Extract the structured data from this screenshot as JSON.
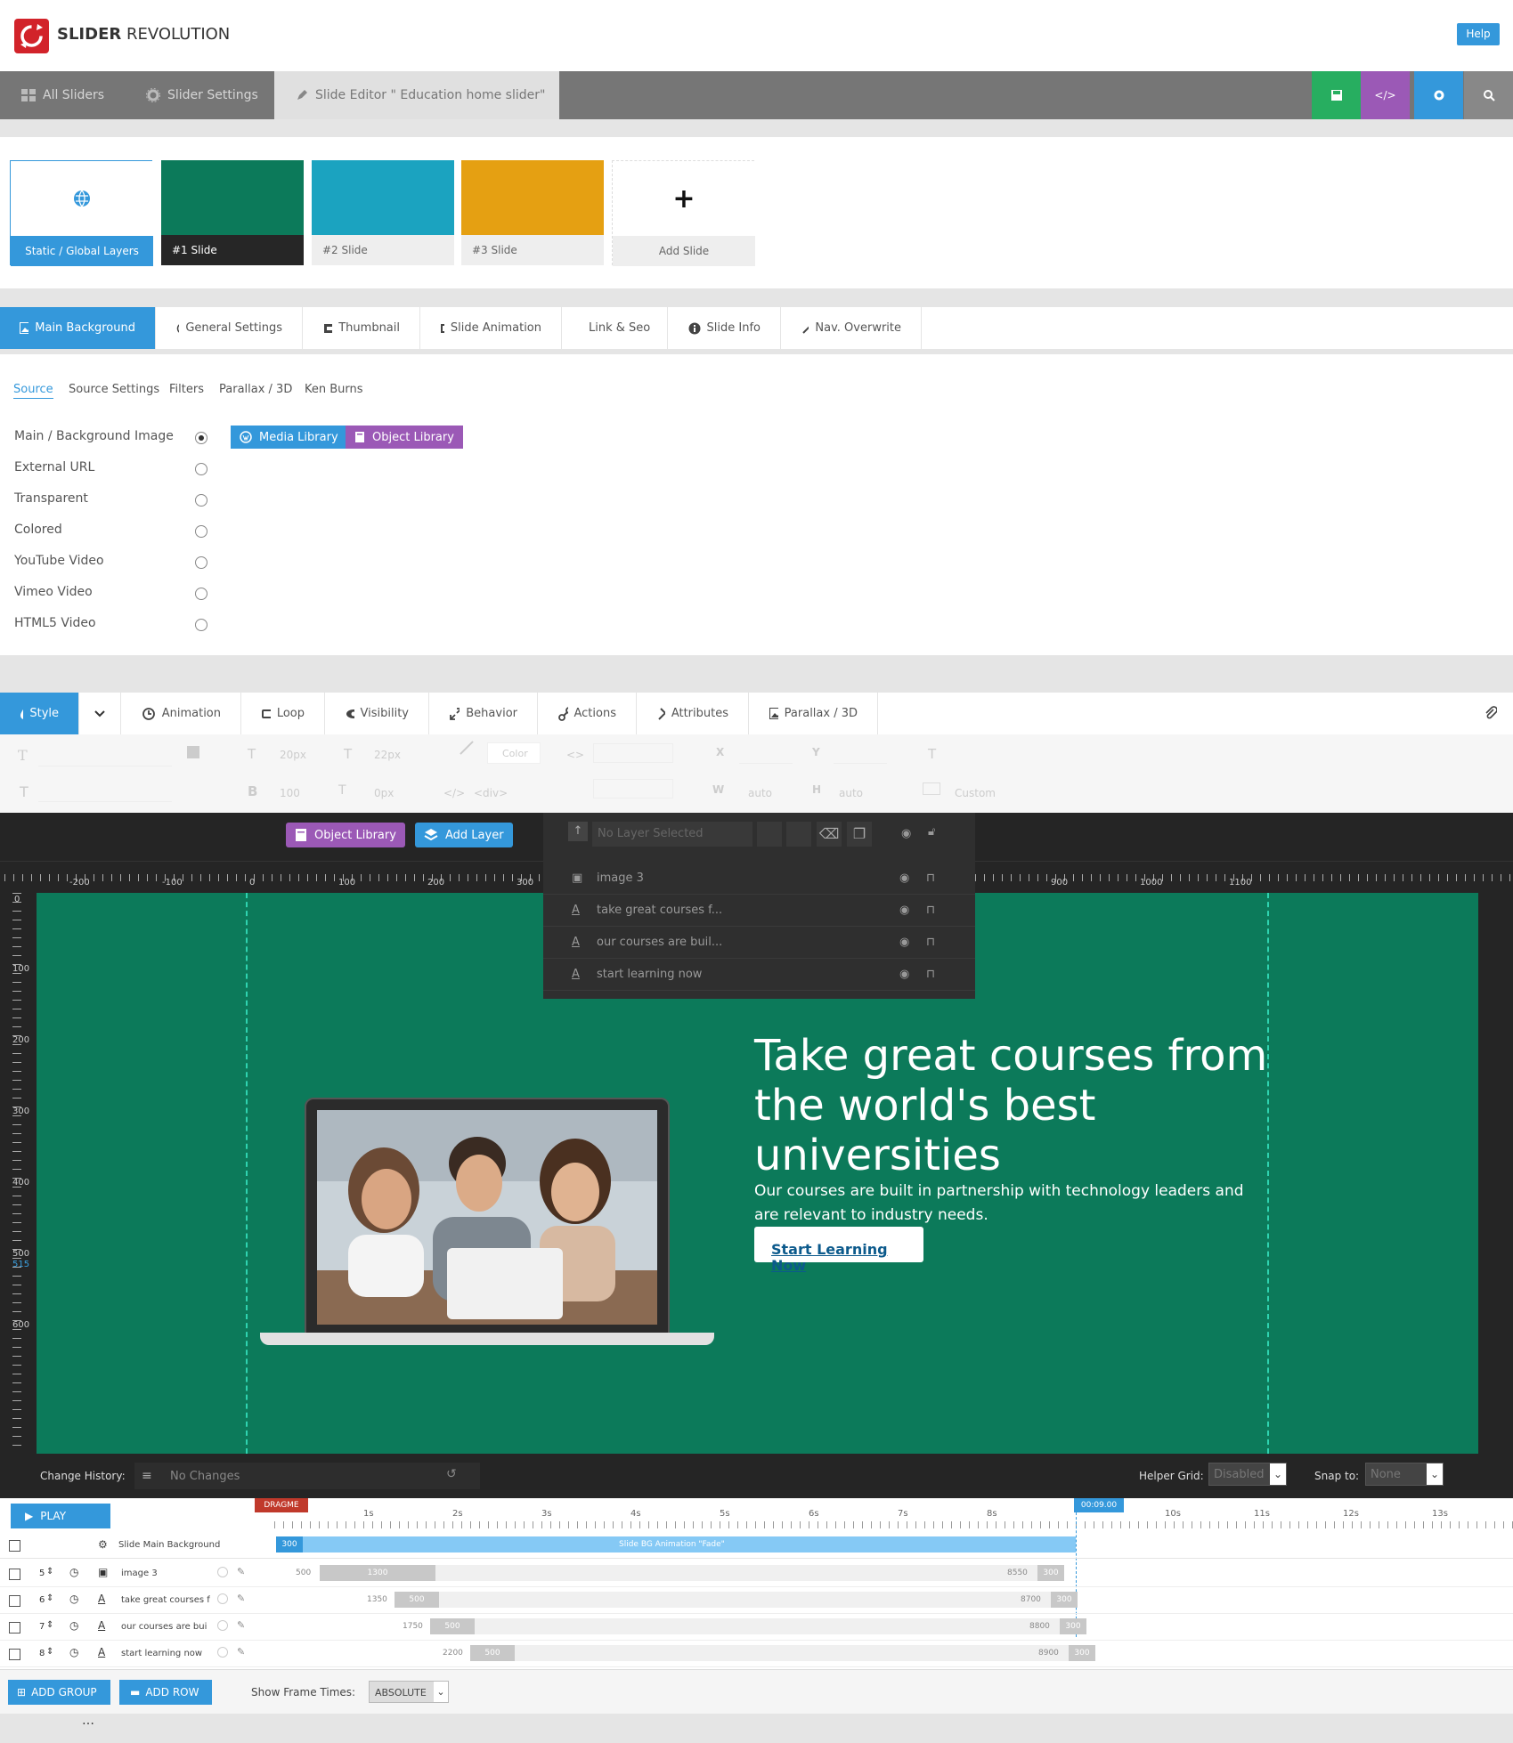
{
  "app": {
    "brand_bold": "SLIDER",
    "brand_light": "REVOLUTION",
    "help_label": "Help"
  },
  "nav": {
    "items": [
      "All Sliders",
      "Slider Settings"
    ],
    "editor_label": "Slide Editor \" Education home slider\"",
    "actions": [
      "save-icon",
      "code-icon",
      "gear-icon",
      "search-icon"
    ]
  },
  "slides": [
    {
      "label": "Static / Global Layers",
      "color": "#ffffff"
    },
    {
      "label": "#1 Slide",
      "color": "#0c7a5a"
    },
    {
      "label": "#2 Slide",
      "color": "#1ba3c0"
    },
    {
      "label": "#3 Slide",
      "color": "#e5a012"
    },
    {
      "label": "Add Slide",
      "color": "#ffffff"
    }
  ],
  "slide_tabs": [
    "Main Background",
    "General Settings",
    "Thumbnail",
    "Slide Animation",
    "Link & Seo",
    "Slide Info",
    "Nav. Overwrite"
  ],
  "source_subtabs": [
    "Source",
    "Source Settings",
    "Filters",
    "Parallax / 3D",
    "Ken Burns"
  ],
  "source_options": [
    "Main / Background Image",
    "External URL",
    "Transparent",
    "Colored",
    "YouTube Video",
    "Vimeo Video",
    "HTML5 Video"
  ],
  "source_selected": 0,
  "media_library_label": "Media Library",
  "object_library_label": "Object Library",
  "layer_tabs": [
    "Style",
    "Animation",
    "Loop",
    "Visibility",
    "Behavior",
    "Actions",
    "Attributes",
    "Parallax / 3D"
  ],
  "toolbar": {
    "font_size": "20px",
    "line_height": "22px",
    "color_label": "Color",
    "weight": "100",
    "spacing": "0px",
    "tag": "<div>",
    "width": "auto",
    "height": "auto",
    "custom": "Custom",
    "x_label": "X",
    "y_label": "Y",
    "w_label": "W",
    "h_label": "H"
  },
  "stage": {
    "object_library_label": "Object Library",
    "add_layer_label": "Add Layer",
    "no_layer_selected": "No Layer Selected",
    "layers": [
      "image 3",
      "take great courses f...",
      "our courses are buil...",
      "start learning now"
    ],
    "ruler_top": [
      "-200",
      "-100",
      "0",
      "100",
      "200",
      "300",
      "900",
      "1000",
      "1100"
    ],
    "ruler_left": [
      "0",
      "100",
      "200",
      "300",
      "400",
      "500",
      "515",
      "600"
    ],
    "headline": "Take great courses from the world's best universities",
    "subtext": "Our courses are built in partnership with technology leaders and are relevant to industry needs.",
    "button_label": "Start Learning Now"
  },
  "history": {
    "label": "Change History:",
    "value": "No Changes",
    "helper_grid_label": "Helper Grid:",
    "helper_grid_value": "Disabled",
    "snap_label": "Snap to:",
    "snap_value": "None"
  },
  "timeline": {
    "play_label": "PLAY",
    "dragme": "DRAGME",
    "time_marker": "00:09.00",
    "ticks": [
      "1s",
      "2s",
      "3s",
      "4s",
      "5s",
      "6s",
      "7s",
      "8s",
      "10s",
      "11s",
      "12s",
      "13s"
    ],
    "main_bg_label": "Slide Main Background",
    "main_bg_start": "300",
    "main_bg_anim": "Slide BG Animation  \"Fade\"",
    "rows": [
      {
        "num": "5",
        "type": "image",
        "name": "image 3",
        "start": "500",
        "in": "1300",
        "end": "8550",
        "out": "300"
      },
      {
        "num": "6",
        "type": "text",
        "name": "take great courses f",
        "start": "1350",
        "in": "500",
        "end": "8700",
        "out": "300"
      },
      {
        "num": "7",
        "type": "text",
        "name": "our courses are bui",
        "start": "1750",
        "in": "500",
        "end": "8800",
        "out": "300"
      },
      {
        "num": "8",
        "type": "text",
        "name": "start learning now",
        "start": "2200",
        "in": "500",
        "end": "8900",
        "out": "300"
      }
    ],
    "add_group_label": "ADD GROUP",
    "add_row_label": "ADD ROW",
    "frame_times_label": "Show Frame Times:",
    "frame_times_value": "ABSOLUTE"
  },
  "colors": {
    "accent": "#3498db",
    "purple": "#9b59b6",
    "green": "#2ecc71",
    "stage_green": "#0c7a5a"
  }
}
